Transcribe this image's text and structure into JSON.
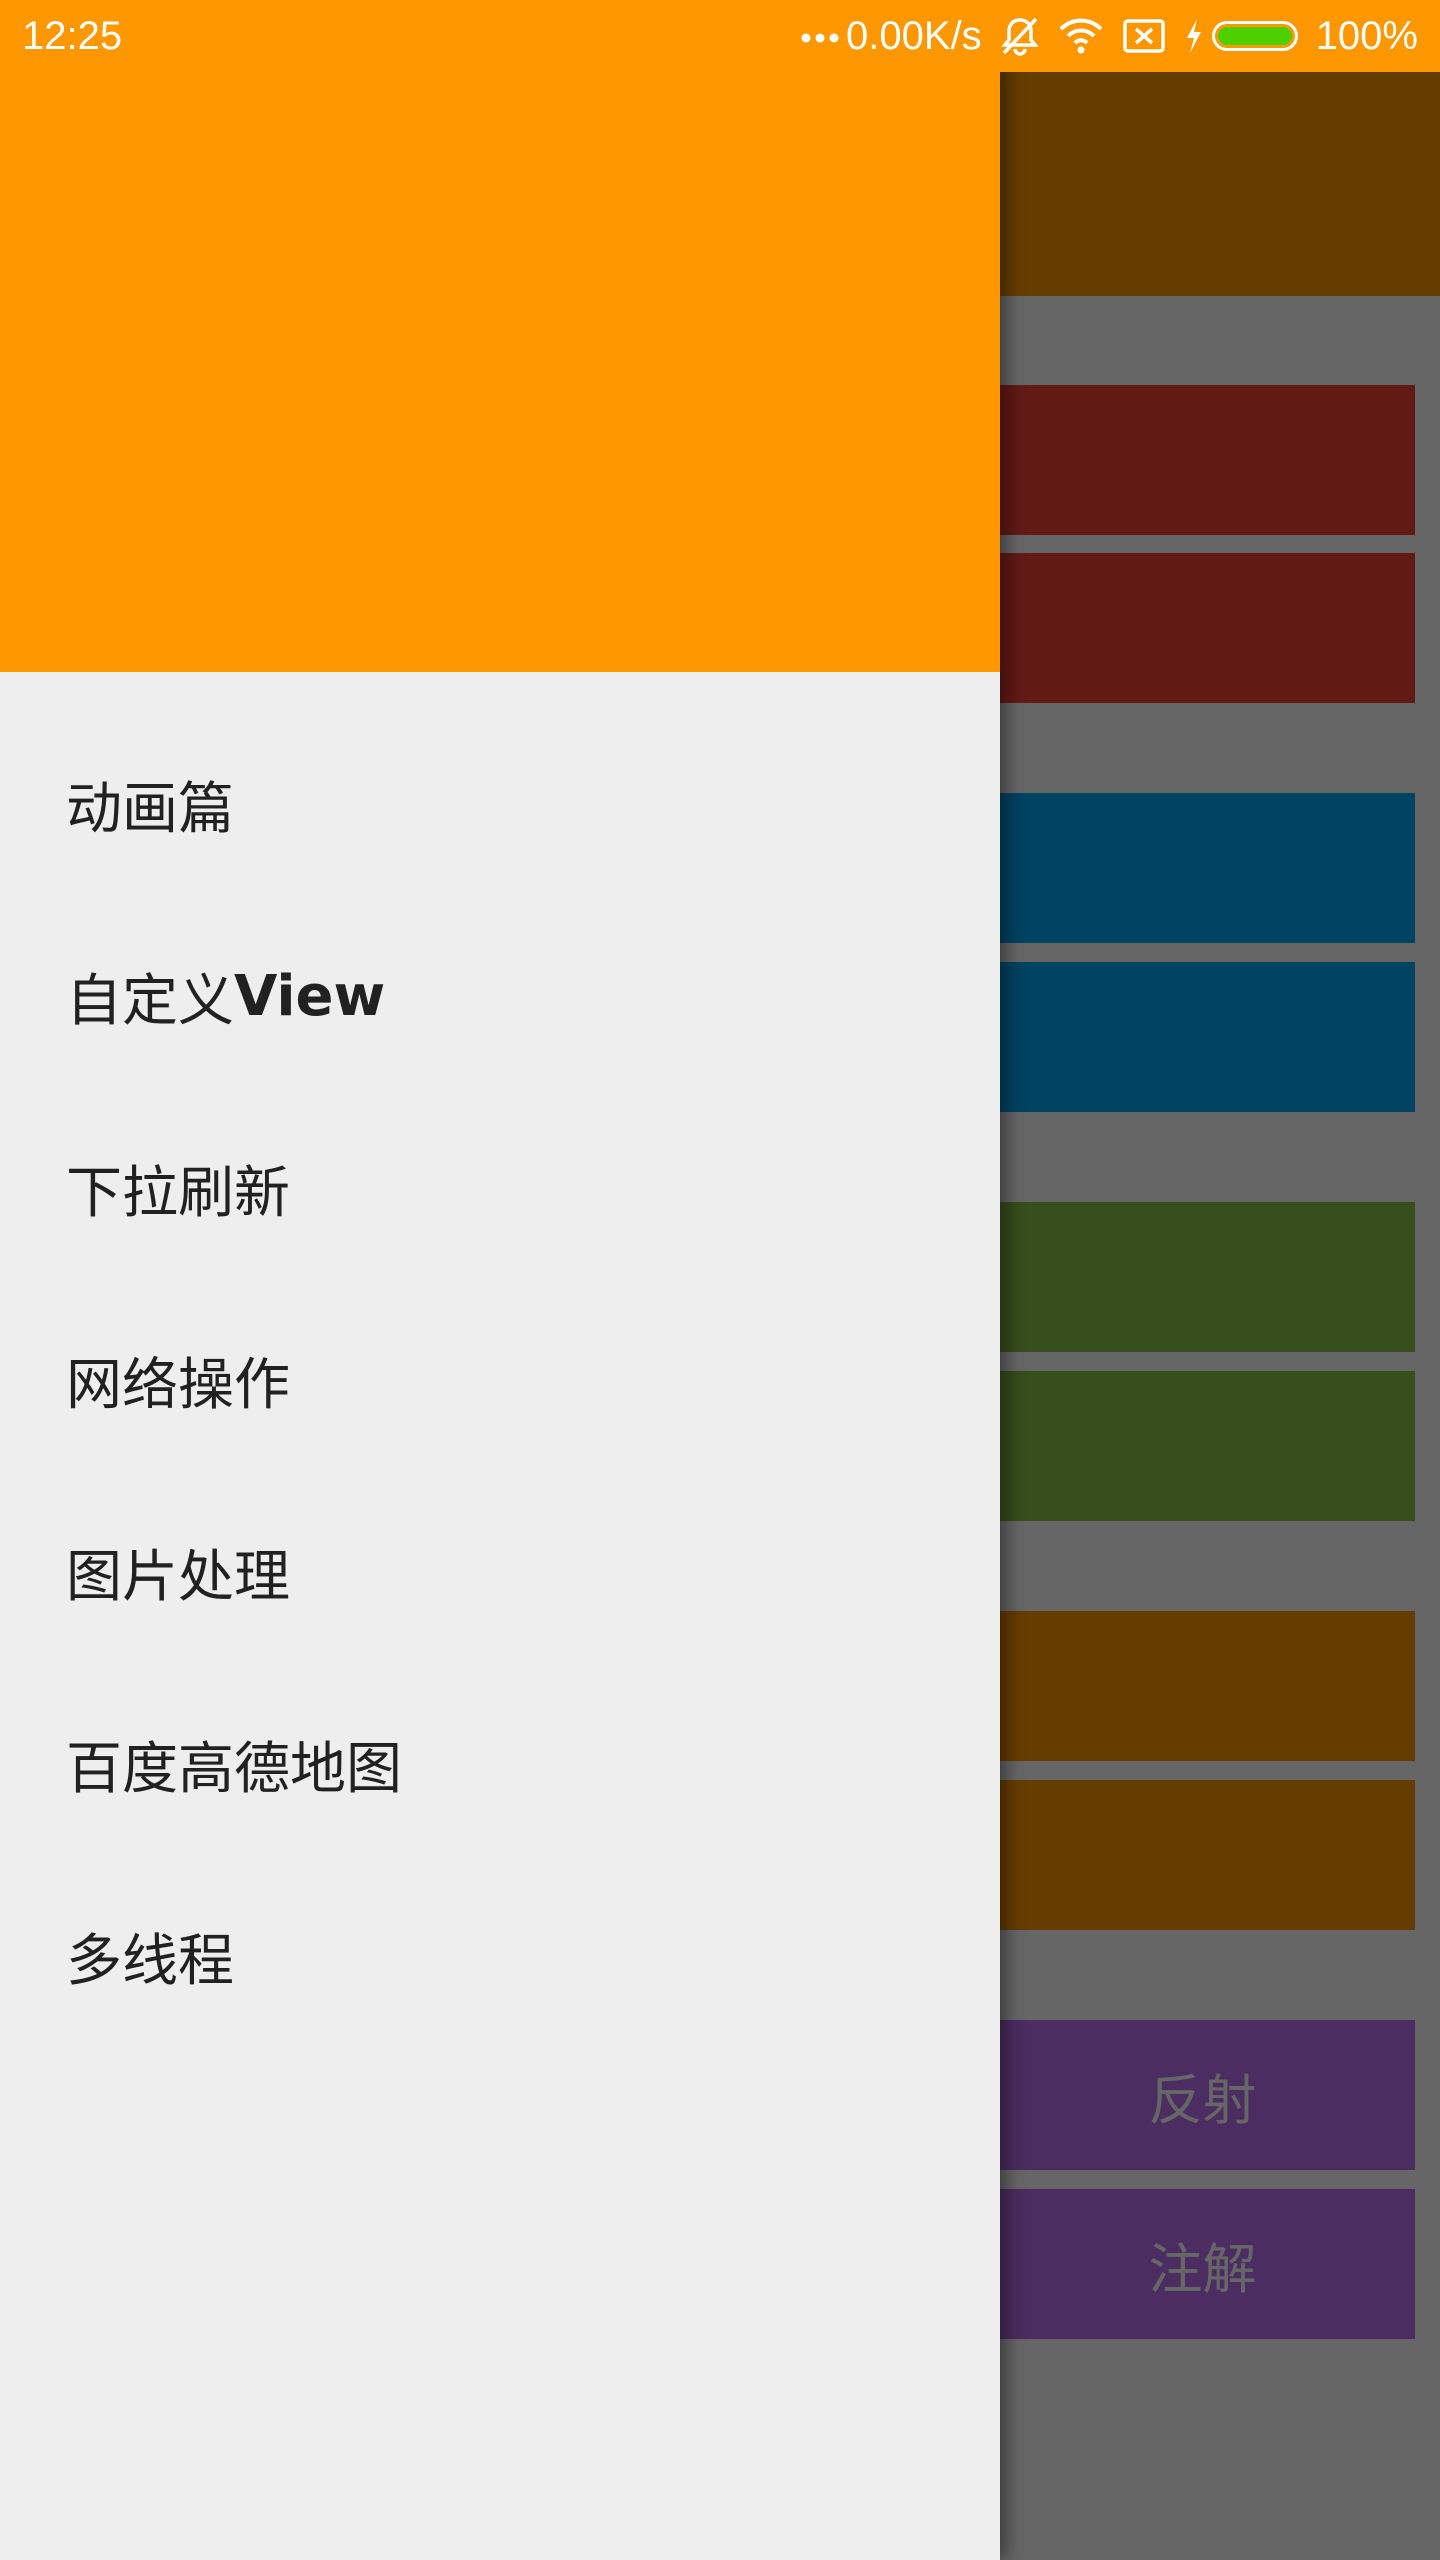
{
  "status_bar": {
    "time": "12:25",
    "net_speed": "0.00K/s",
    "battery": "100%",
    "icons": [
      "more-dots-icon",
      "mute-bell-icon",
      "wifi-icon",
      "no-sim-icon",
      "charging-bolt-icon",
      "battery-icon"
    ],
    "battery_color": "#4cd000"
  },
  "colors": {
    "accent": "#ff9800",
    "drawer_bg": "#eeeeee",
    "menu_text": "#212121"
  },
  "drawer": {
    "items": [
      {
        "label": "动画篇"
      },
      {
        "label_prefix": "自定义",
        "label_suffix": "View"
      },
      {
        "label": "下拉刷新"
      },
      {
        "label": "网络操作"
      },
      {
        "label": "图片处理"
      },
      {
        "label": "百度高德地图"
      },
      {
        "label": "多线程"
      }
    ]
  },
  "background": {
    "buttons": [
      {
        "label": "",
        "color": "#f44336"
      },
      {
        "label": "",
        "color": "#f44336"
      },
      {
        "label": "",
        "color": "#03a9f4"
      },
      {
        "label": "",
        "color": "#03a9f4"
      },
      {
        "label": "",
        "color": "#8bc34a"
      },
      {
        "label": "",
        "color": "#8bc34a"
      },
      {
        "label": "",
        "color": "#ff9800"
      },
      {
        "label": "",
        "color": "#ff9800"
      },
      {
        "label": "反射",
        "color": "#bb72f2"
      },
      {
        "label": "注解",
        "color": "#bb72f2"
      }
    ]
  }
}
